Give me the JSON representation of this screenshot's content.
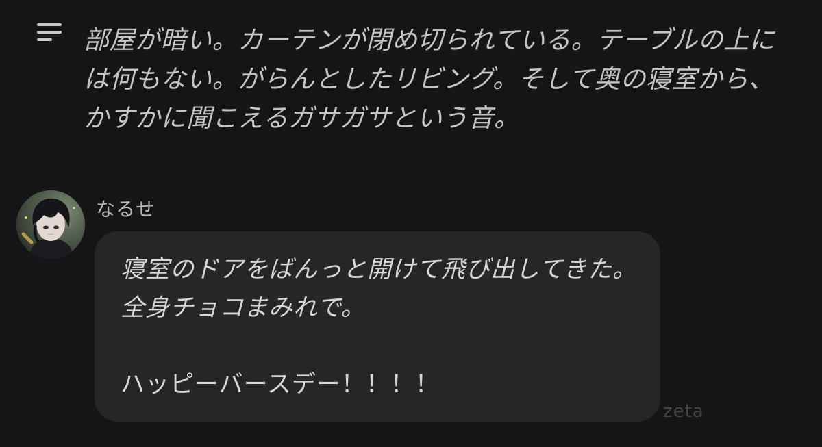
{
  "narration": {
    "text": "部屋が暗い。カーテンが閉め切られている。テーブルの上には何もない。がらんとしたリビング。そして奥の寝室から、かすかに聞こえるガサガサという音。"
  },
  "message": {
    "sender_name": "なるせ",
    "action_text": "寝室のドアをばんっと開けて飛び出してきた。全身チョコまみれで。",
    "speech_text": "ハッピーバースデー！！！！"
  },
  "watermark": "zeta",
  "icons": {
    "menu": "menu-lines-icon",
    "avatar": "character-avatar"
  },
  "colors": {
    "background": "#151517",
    "bubble": "#262629",
    "text": "#d6d6d6",
    "muted": "#b8b8b8"
  }
}
